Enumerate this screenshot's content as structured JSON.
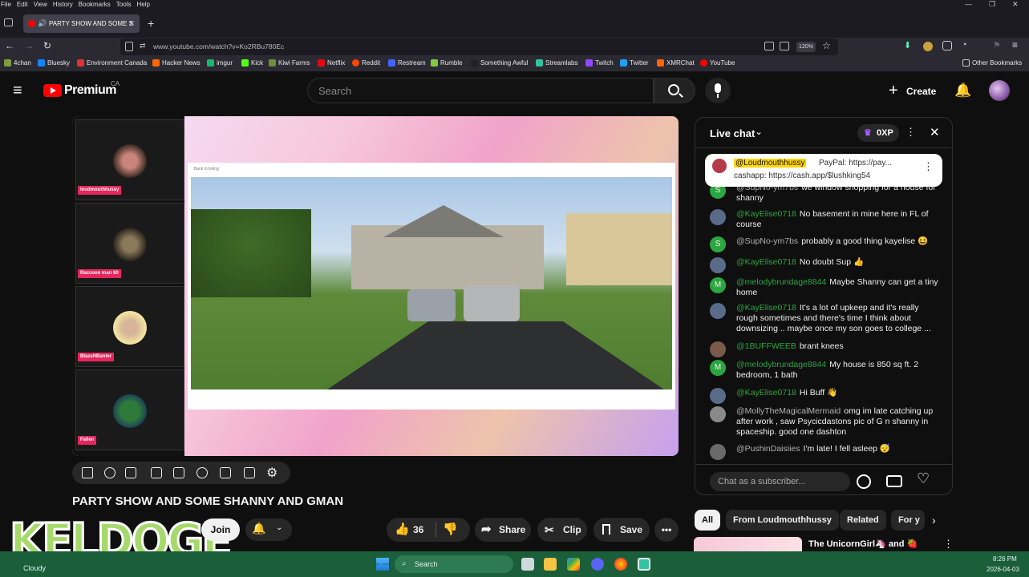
{
  "browser": {
    "menu": [
      "File",
      "Edit",
      "View",
      "History",
      "Bookmarks",
      "Tools",
      "Help"
    ],
    "tab_title": "PARTY SHOW AND SOME S",
    "url": "www.youtube.com/watch?v=Ko2RBu780Ec",
    "zoom": "120%",
    "bookmarks": [
      "4chan",
      "Bluesky",
      "Environment Canada",
      "Hacker News",
      "imgur",
      "Kick",
      "Kiwi Farms",
      "Netflix",
      "Reddit",
      "Restream",
      "Rumble",
      "Something Awful",
      "Streamlabs",
      "Twitch",
      "Twitter",
      "XMRChat",
      "YouTube"
    ],
    "other_bookmarks": "Other Bookmarks"
  },
  "yt": {
    "logo_text": "Premium",
    "region": "CA",
    "search_placeholder": "Search",
    "create_label": "Create"
  },
  "video": {
    "title": "PARTY SHOW AND SOME SHANNY AND GMAN",
    "cams": [
      "loudmouthhussy",
      "Raccoon man 60",
      "BlazeNBanter",
      "Fallen"
    ],
    "screen_nav_label": "Back to listing",
    "like_count": "36",
    "share_label": "Share",
    "clip_label": "Clip",
    "save_label": "Save",
    "join_label": "Join",
    "overlay_text": "KELDOGE"
  },
  "chat": {
    "title": "Live chat",
    "xp": "0XP",
    "pinned": {
      "author": "@Loudmouthhussy",
      "line1": "PayPal: https://pay...",
      "line2": "cashapp: https://cash.app/$lushking54"
    },
    "messages": [
      {
        "author": "@SupNo-ym7bs",
        "text": "we window shopping for a house for shanny",
        "color": "#2ba640",
        "initial": "S"
      },
      {
        "author": "@KayElise0718",
        "text": "No basement in mine here in FL of course",
        "color": "#5a6b8a",
        "initial": ""
      },
      {
        "author": "@SupNo-ym7bs",
        "text": "probably a good thing kayelise 😆",
        "color": "#2ba640",
        "initial": "S"
      },
      {
        "author": "@KayElise0718",
        "text": "No doubt Sup 👍",
        "color": "#5a6b8a",
        "initial": ""
      },
      {
        "author": "@melodybrundage8844",
        "text": "Maybe Shanny can get a tiny home",
        "color": "#2ba640",
        "initial": "M"
      },
      {
        "author": "@KayElise0718",
        "text": "It's a lot of upkeep and it's really rough sometimes and there's time I think about downsizing .. maybe once my son goes to college ...",
        "color": "#5a6b8a",
        "initial": ""
      },
      {
        "author": "@1BUFFWEEB",
        "text": "brant knees",
        "color": "#7a5a4a",
        "initial": ""
      },
      {
        "author": "@melodybrundage8844",
        "text": "My house is 850 sq ft. 2 bedroom, 1 bath",
        "color": "#2ba640",
        "initial": "M"
      },
      {
        "author": "@KayElise0718",
        "text": "Hi Buff 👋",
        "color": "#5a6b8a",
        "initial": ""
      },
      {
        "author": "@MollyTheMagicalMermaid",
        "text": "omg im late catching up after work , saw Psycicdastons pic of G n shanny in spaceship. good one dashton",
        "color": "#8a8a8a",
        "initial": ""
      },
      {
        "author": "@PushinDaisiies",
        "text": "I'm late! I fell asleep 😴",
        "color": "#6a6a6a",
        "initial": ""
      }
    ],
    "input_placeholder": "Chat as a subscriber..."
  },
  "chips": [
    "All",
    "From Loudmouthhussy",
    "Related",
    "For y"
  ],
  "next_video_title": "The UnicornGirl🦄 and 🍓",
  "taskbar": {
    "weather": "Cloudy",
    "search": "Search",
    "time": "8:26 PM",
    "date": "2026-04-03"
  }
}
